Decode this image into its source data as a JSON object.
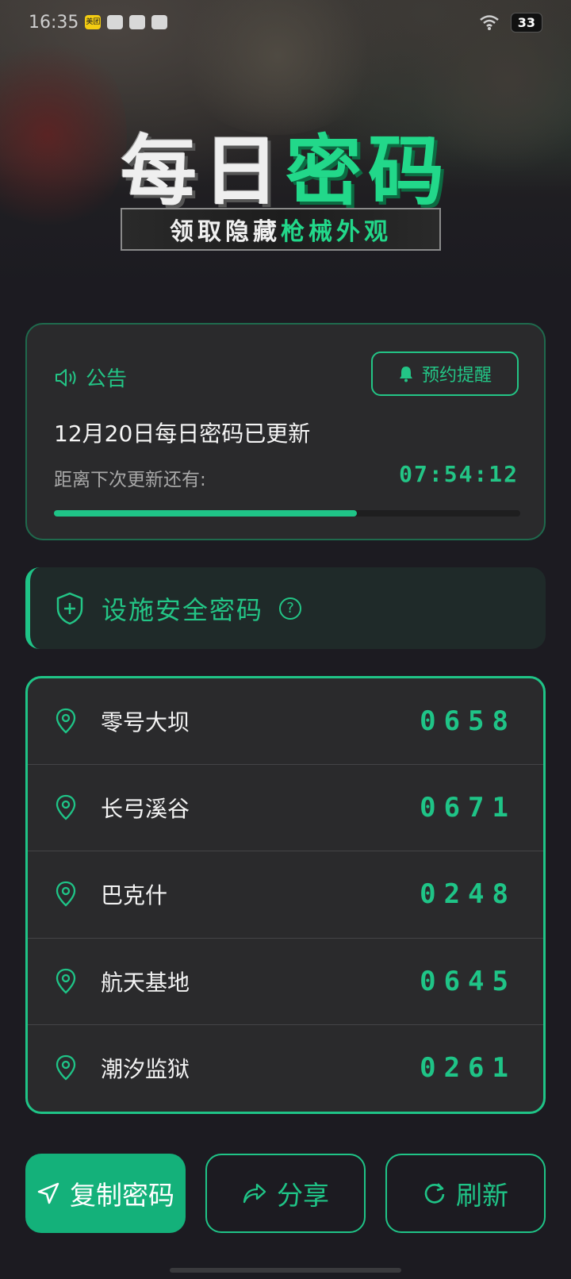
{
  "status_bar": {
    "time": "16:35",
    "app_badge": "美团",
    "battery": "33"
  },
  "hero": {
    "title_white": "每日",
    "title_green": "密码",
    "subtitle_white": "领取隐藏",
    "subtitle_green": "枪械外观"
  },
  "notice": {
    "label": "公告",
    "remind_label": "预约提醒",
    "title": "12月20日每日密码已更新",
    "countdown_label": "距离下次更新还有:",
    "countdown_value": "07:54:12",
    "progress_percent": 65
  },
  "safe_section": {
    "title": "设施安全密码",
    "help": "?"
  },
  "codes": [
    {
      "name": "零号大坝",
      "code": "0658"
    },
    {
      "name": "长弓溪谷",
      "code": "0671"
    },
    {
      "name": "巴克什",
      "code": "0248"
    },
    {
      "name": "航天基地",
      "code": "0645"
    },
    {
      "name": "潮汐监狱",
      "code": "0261"
    }
  ],
  "actions": {
    "copy": "复制密码",
    "share": "分享",
    "refresh": "刷新"
  },
  "colors": {
    "accent": "#1fc487",
    "background": "#1c1b21",
    "card": "#2a2a2c"
  }
}
